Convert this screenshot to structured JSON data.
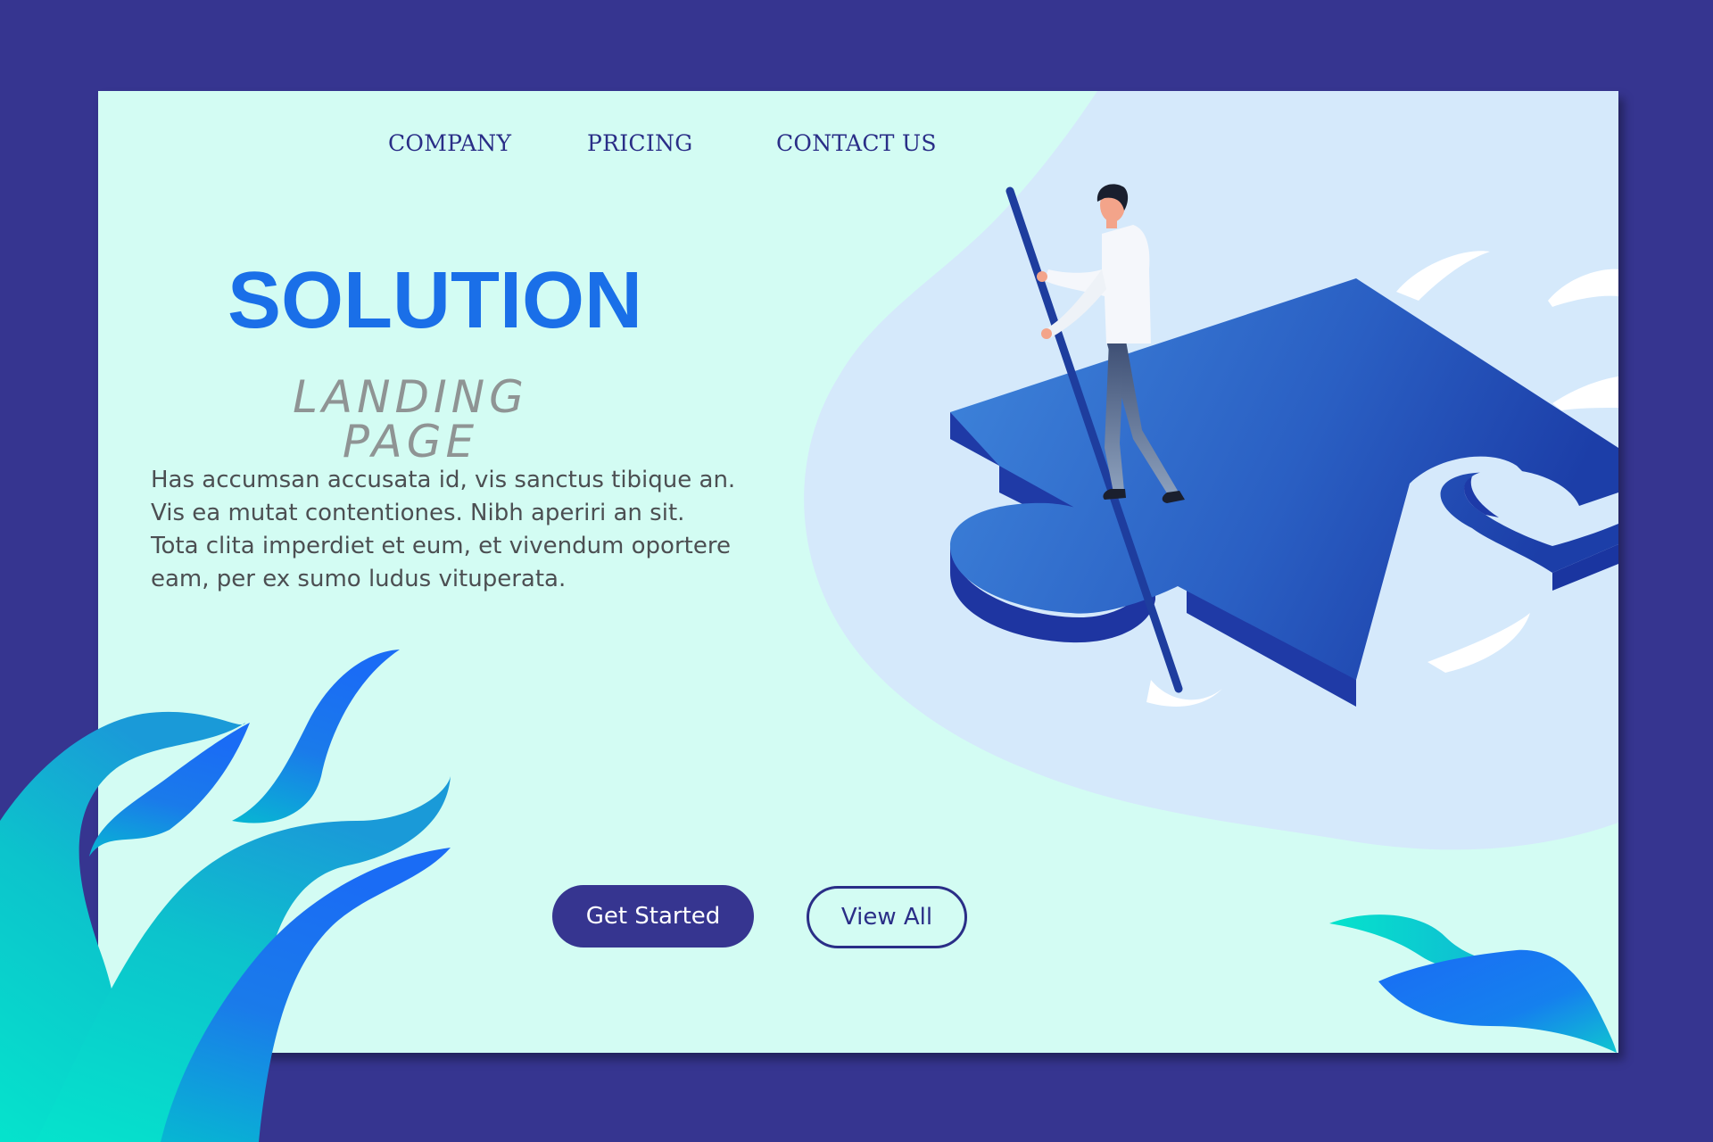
{
  "nav": {
    "company_label": "COMPANY",
    "pricing_label": "PRICING",
    "contact_label": "CONTACT US"
  },
  "hero": {
    "title": "SOLUTION",
    "subtitle": "LANDING PAGE",
    "body_lines": [
      "Has accumsan accusata id, vis sanctus tibique an.",
      "Vis ea mutat contentiones. Nibh aperiri an sit.",
      "Tota clita imperdiet et eum, et vivendum oportere",
      "eam, per ex sumo ludus vituperata."
    ]
  },
  "actions": {
    "get_started_label": "Get Started",
    "view_all_label": "View All"
  },
  "colors": {
    "outer_background": "#363590",
    "card_background": "#d3fcf3",
    "blob": "#d5e9fb",
    "title_accent": "#1a6fe8",
    "nav_text": "#2a2e87",
    "puzzle_top": "#2f6fcd",
    "puzzle_side": "#1f3aa6",
    "leaf_teal": "#05dfc9",
    "leaf_blue": "#1a6cf5"
  },
  "icons": {
    "illustration": "person-on-puzzle-piece",
    "decoration": "leaf-shapes"
  }
}
